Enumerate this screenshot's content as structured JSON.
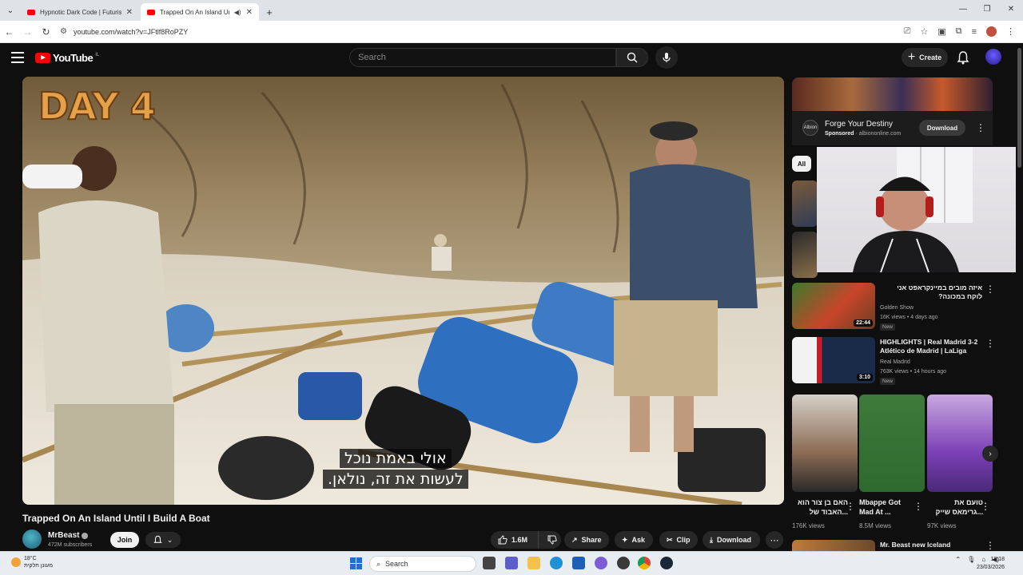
{
  "browser": {
    "tabs": [
      {
        "title": "Hypnotic Dark Code | Futuristic",
        "active": false
      },
      {
        "title": "Trapped On An Island Until",
        "active": true
      }
    ],
    "new_tab": "+",
    "url": "youtube.com/watch?v=JFtlf8RoPZY"
  },
  "youtube": {
    "logo_text": "YouTube",
    "logo_region": "IL",
    "search_placeholder": "Search",
    "create_label": "Create"
  },
  "video": {
    "overlay_day": "DAY 4",
    "caption_lines": [
      "אולי באמת נוכל",
      "לעשות את זה, נולאן."
    ],
    "title": "Trapped On An Island Until I Build A Boat",
    "channel": "MrBeast",
    "subscribers": "472M subscribers",
    "join_label": "Join",
    "likes": "1.6M",
    "share_label": "Share",
    "ask_label": "Ask",
    "clip_label": "Clip",
    "download_label": "Download"
  },
  "sidebar": {
    "ad": {
      "logo": "Albion",
      "title": "Forge Your Destiny",
      "sponsored": "Sponsored",
      "domain": "albiononline.com",
      "button": "Download"
    },
    "chip_all": "All",
    "related": [
      {
        "title": "איזה מובים במיינקראפט אני לוקח במכונה?",
        "channel": "Golden Show",
        "meta": "16K views • 4 days ago",
        "badge": "New",
        "duration": "22:44"
      },
      {
        "title": "HIGHLIGHTS | Real Madrid 3-2 Atlético de Madrid | LaLiga",
        "channel": "Real Madrid",
        "meta": "763K views • 14 hours ago",
        "badge": "New",
        "duration": "3:10"
      }
    ],
    "shorts": [
      {
        "title": "האם בן צור הוא ...האבוד של",
        "views": "176K views"
      },
      {
        "title": "Mbappe Got Mad At ...",
        "views": "8.5M views"
      },
      {
        "title": "טועם את ...גרימאס שייק",
        "views": "97K views"
      }
    ],
    "next_video_title": "Mr. Beast new Iceland"
  },
  "taskbar": {
    "temp": "18°C",
    "weather_desc": "מעונן חלקית",
    "search_label": "Search",
    "time": "18:18",
    "date": "23/03/2026"
  }
}
